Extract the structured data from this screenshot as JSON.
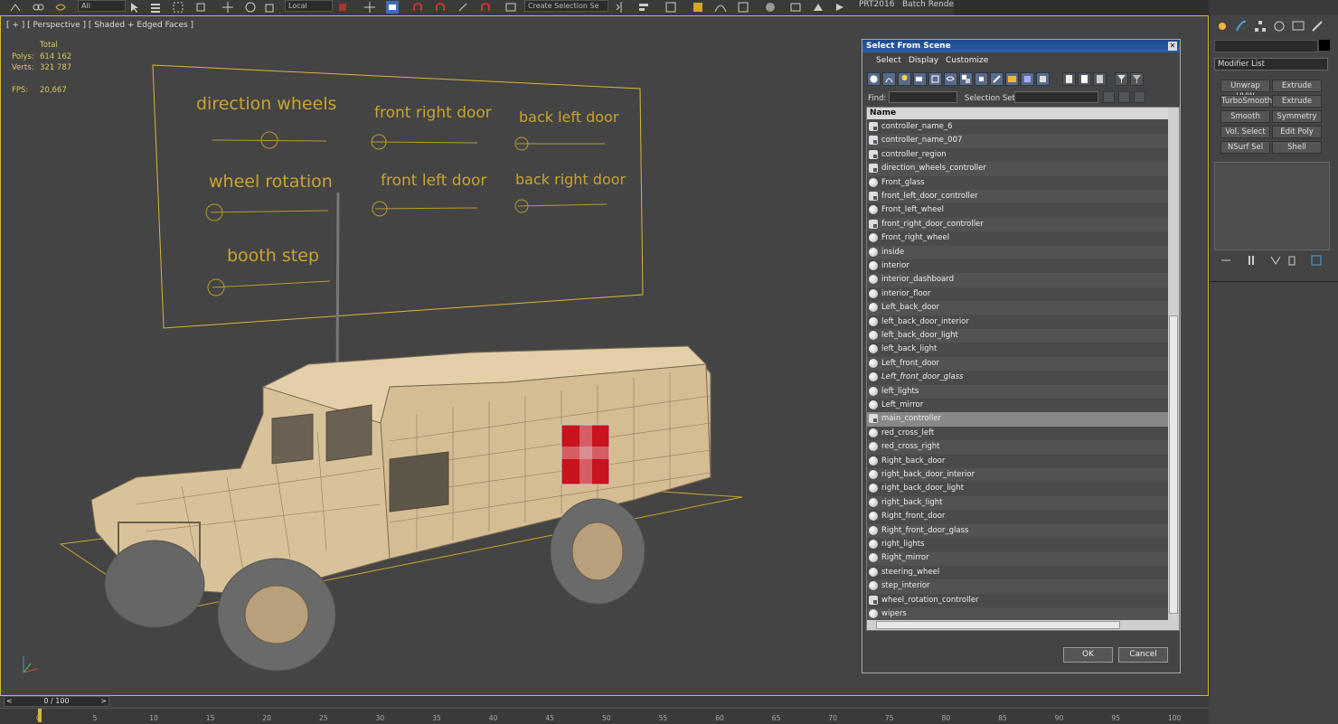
{
  "toolbar": {
    "ref_coord": "Local",
    "all_filter": "All",
    "named_selection": "Create Selection Se",
    "prt_label": "PRT2016",
    "batch_render": "Batch Render.."
  },
  "viewport": {
    "label": "[ + ] [ Perspective ] [ Shaded + Edged Faces ]",
    "stats": {
      "total_label": "Total",
      "polys_label": "Polys:",
      "polys_value": "614 162",
      "verts_label": "Verts:",
      "verts_value": "321 787",
      "fps_label": "FPS:",
      "fps_value": "20,667"
    },
    "controllers": {
      "direction_wheels": "direction wheels",
      "front_right_door": "front right door",
      "back_left_door": "back left door",
      "wheel_rotation": "wheel rotation",
      "front_left_door": "front left door",
      "back_right_door": "back right door",
      "booth_step": "booth step"
    }
  },
  "dialog": {
    "title": "Select From Scene",
    "close_glyph": "✕",
    "menu": [
      "Select",
      "Display",
      "Customize"
    ],
    "find_label": "Find:",
    "selection_set_label": "Selection Set:",
    "column_name": "Name",
    "items": [
      {
        "name": "controller_name_6",
        "type": "ctrl"
      },
      {
        "name": "controller_name_007",
        "type": "ctrl"
      },
      {
        "name": "controller_region",
        "type": "ctrl"
      },
      {
        "name": "direction_wheels_controller",
        "type": "ctrl"
      },
      {
        "name": "Front_glass",
        "type": "mesh"
      },
      {
        "name": "front_left_door_controller",
        "type": "ctrl"
      },
      {
        "name": "Front_left_wheel",
        "type": "mesh"
      },
      {
        "name": "front_right_door_controller",
        "type": "ctrl"
      },
      {
        "name": "Front_right_wheel",
        "type": "mesh"
      },
      {
        "name": "inside",
        "type": "mesh"
      },
      {
        "name": "interior",
        "type": "mesh"
      },
      {
        "name": "interior_dashboard",
        "type": "mesh"
      },
      {
        "name": "interior_floor",
        "type": "mesh"
      },
      {
        "name": "Left_back_door",
        "type": "mesh"
      },
      {
        "name": "left_back_door_interior",
        "type": "mesh"
      },
      {
        "name": "left_back_door_light",
        "type": "mesh"
      },
      {
        "name": "left_back_light",
        "type": "mesh"
      },
      {
        "name": "Left_front_door",
        "type": "mesh"
      },
      {
        "name": "Left_front_door_glass",
        "type": "mesh",
        "italic": true
      },
      {
        "name": "left_lights",
        "type": "mesh"
      },
      {
        "name": "Left_mirror",
        "type": "mesh"
      },
      {
        "name": "main_controller",
        "type": "ctrl",
        "selected": true
      },
      {
        "name": "red_cross_left",
        "type": "mesh"
      },
      {
        "name": "red_cross_right",
        "type": "mesh"
      },
      {
        "name": "Right_back_door",
        "type": "mesh"
      },
      {
        "name": "right_back_door_interior",
        "type": "mesh"
      },
      {
        "name": "right_back_door_light",
        "type": "mesh"
      },
      {
        "name": "right_back_light",
        "type": "mesh"
      },
      {
        "name": "Right_front_door",
        "type": "mesh"
      },
      {
        "name": "Right_front_door_glass",
        "type": "mesh"
      },
      {
        "name": "right_lights",
        "type": "mesh"
      },
      {
        "name": "Right_mirror",
        "type": "mesh"
      },
      {
        "name": "steering_wheel",
        "type": "mesh"
      },
      {
        "name": "step_interior",
        "type": "mesh"
      },
      {
        "name": "wheel_rotation_controller",
        "type": "ctrl"
      },
      {
        "name": "wipers",
        "type": "mesh"
      }
    ],
    "ok_label": "OK",
    "cancel_label": "Cancel"
  },
  "command_panel": {
    "modifier_list": "Modifier List",
    "buttons": [
      "Unwrap UVW",
      "Extrude",
      "TurboSmooth",
      "Extrude",
      "Smooth",
      "Symmetry",
      "Vol. Select",
      "Edit Poly",
      "NSurf Sel",
      "Shell"
    ]
  },
  "timeline": {
    "frame": "0 / 100",
    "prev_glyph": "<",
    "next_glyph": ">",
    "ticks": [
      "0",
      "5",
      "10",
      "15",
      "20",
      "25",
      "30",
      "35",
      "40",
      "45",
      "50",
      "55",
      "60",
      "65",
      "70",
      "75",
      "80",
      "85",
      "90",
      "95",
      "100"
    ]
  },
  "colors": {
    "accent_yellow": "#d9b636",
    "dialog_title": "#2a5fa8",
    "vehicle_tan": "#d8c29a",
    "red_cross": "#c8141e"
  }
}
